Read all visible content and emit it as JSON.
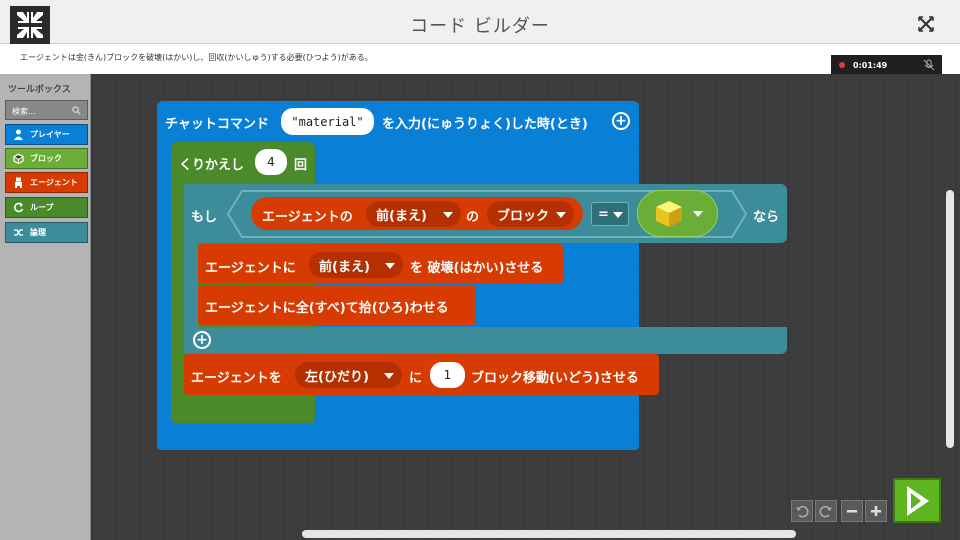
{
  "window": {
    "title": "コード ビルダー",
    "instruction": "エージェントは金(きん)ブロックを破壊(はかい)し、回収(かいしゅう)する必要(ひつよう)がある。"
  },
  "recorder": {
    "time": "0:01:49"
  },
  "toolbox": {
    "title": "ツールボックス",
    "search_placeholder": "検索...",
    "categories": [
      {
        "label": "プレイヤー",
        "color": "#0a7fd6",
        "icon": "person-icon"
      },
      {
        "label": "ブロック",
        "color": "#6aad37",
        "icon": "cube-icon"
      },
      {
        "label": "エージェント",
        "color": "#d83b01",
        "icon": "agent-icon"
      },
      {
        "label": "ループ",
        "color": "#4a8a2a",
        "icon": "loop-icon"
      },
      {
        "label": "論理",
        "color": "#3d8c9a",
        "icon": "shuffle-icon"
      }
    ]
  },
  "blocks": {
    "chat": {
      "prefix": "チャットコマンド",
      "value": "\"material\"",
      "suffix": "を入力(にゅうりょく)した時(とき)"
    },
    "repeat": {
      "prefix": "くりかえし",
      "count": "4",
      "suffix": "回"
    },
    "if": {
      "prefix": "もし",
      "agent_label": "エージェントの",
      "direction": "前(まえ)",
      "of": "の",
      "item": "ブロック",
      "operator": "=",
      "then": "なら"
    },
    "destroy": {
      "prefix": "エージェントに",
      "direction": "前(まえ)",
      "suffix": "を 破壊(はかい)させる"
    },
    "collect": {
      "label": "エージェントに全(すべ)て拾(ひろ)わせる"
    },
    "move": {
      "prefix": "エージェントを",
      "direction": "左(ひだり)",
      "to": "に",
      "amount": "1",
      "suffix": "ブロック移動(いどう)させる"
    }
  },
  "colors": {
    "player_blue": "#0a7fd6",
    "loop_green": "#4a8a2a",
    "logic_teal": "#3d8c9a",
    "agent_orange": "#d83b01",
    "run_green": "#5fb520"
  }
}
